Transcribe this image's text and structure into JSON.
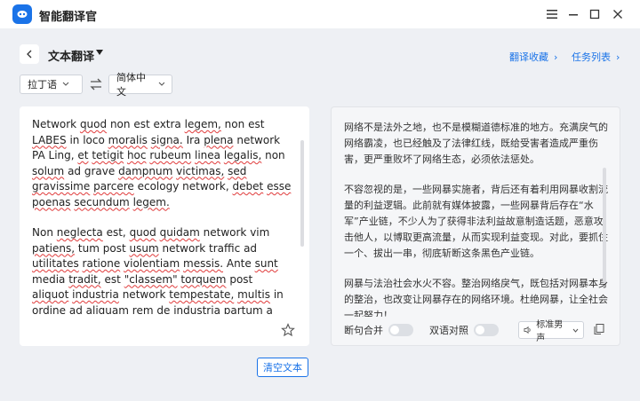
{
  "window": {
    "title": "智能翻译官"
  },
  "header": {
    "mode_title": "文本翻译",
    "link_collection": "翻译收藏",
    "link_tasks": "任务列表"
  },
  "languages": {
    "source": "拉丁语",
    "target": "简体中文"
  },
  "source_text": {
    "p1": "Network quod non est extra legem, non est LABES in loco moralis signa. Ira plena network PA Ling, et tetigit hoc rubeum linea legalis, non solum ad grave dampnum victimas, sed gravissime parcere ecology network, debet esse poenas secundum legem.",
    "p2": "Non neglecta est, quod quidam network vim patiens, tum post usum network traffic ad utilitates ratione violentiam messis. Ante sunt media tradit, est \"classem\" torquem post aliquot industria network tempestate, multis in ordine ad aliquam rem de industria partum a thema contra legem, malicious impetus aliis, ut vincere altius traffic, ut consequi utilitates cash. Hoc capere"
  },
  "target_text": {
    "p1": "网络不是法外之地，也不是模糊道德标准的地方。充满戾气的网络霸凌，也已经触及了法律红线，既给受害者造成严重伤害，更严重败坏了网络生态，必须依法惩处。",
    "p2": "不容忽视的是，一些网暴实施者，背后还有着利用网暴收割流量的利益逻辑。此前就有媒体披露，一些网暴背后存在“水军”产业链，不少人为了获得非法利益故意制造话题，恶意攻击他人，以博取更高流量，从而实现利益变现。对此，要抓住一个、拔出一串，彻底斩断这条黑色产业链。",
    "p3": "网暴与法治社会水火不容。整治网络戾气，既包括对网暴本身的整治，也改变让网暴存在的网络环境。杜绝网暴，让全社会一起努力！"
  },
  "controls": {
    "clear_button": "清空文本",
    "toggle_merge": "断句合并",
    "toggle_bilingual": "双语对照",
    "voice": "标准男声"
  },
  "colors": {
    "accent": "#1a73e8",
    "spell_error": "#e03b3b"
  },
  "icons": [
    "app-logo-icon",
    "minimize-icon",
    "maximize-icon",
    "close-icon",
    "menu-icon",
    "back-chevron-icon",
    "swap-icon",
    "star-icon",
    "speaker-icon",
    "copy-icon"
  ]
}
